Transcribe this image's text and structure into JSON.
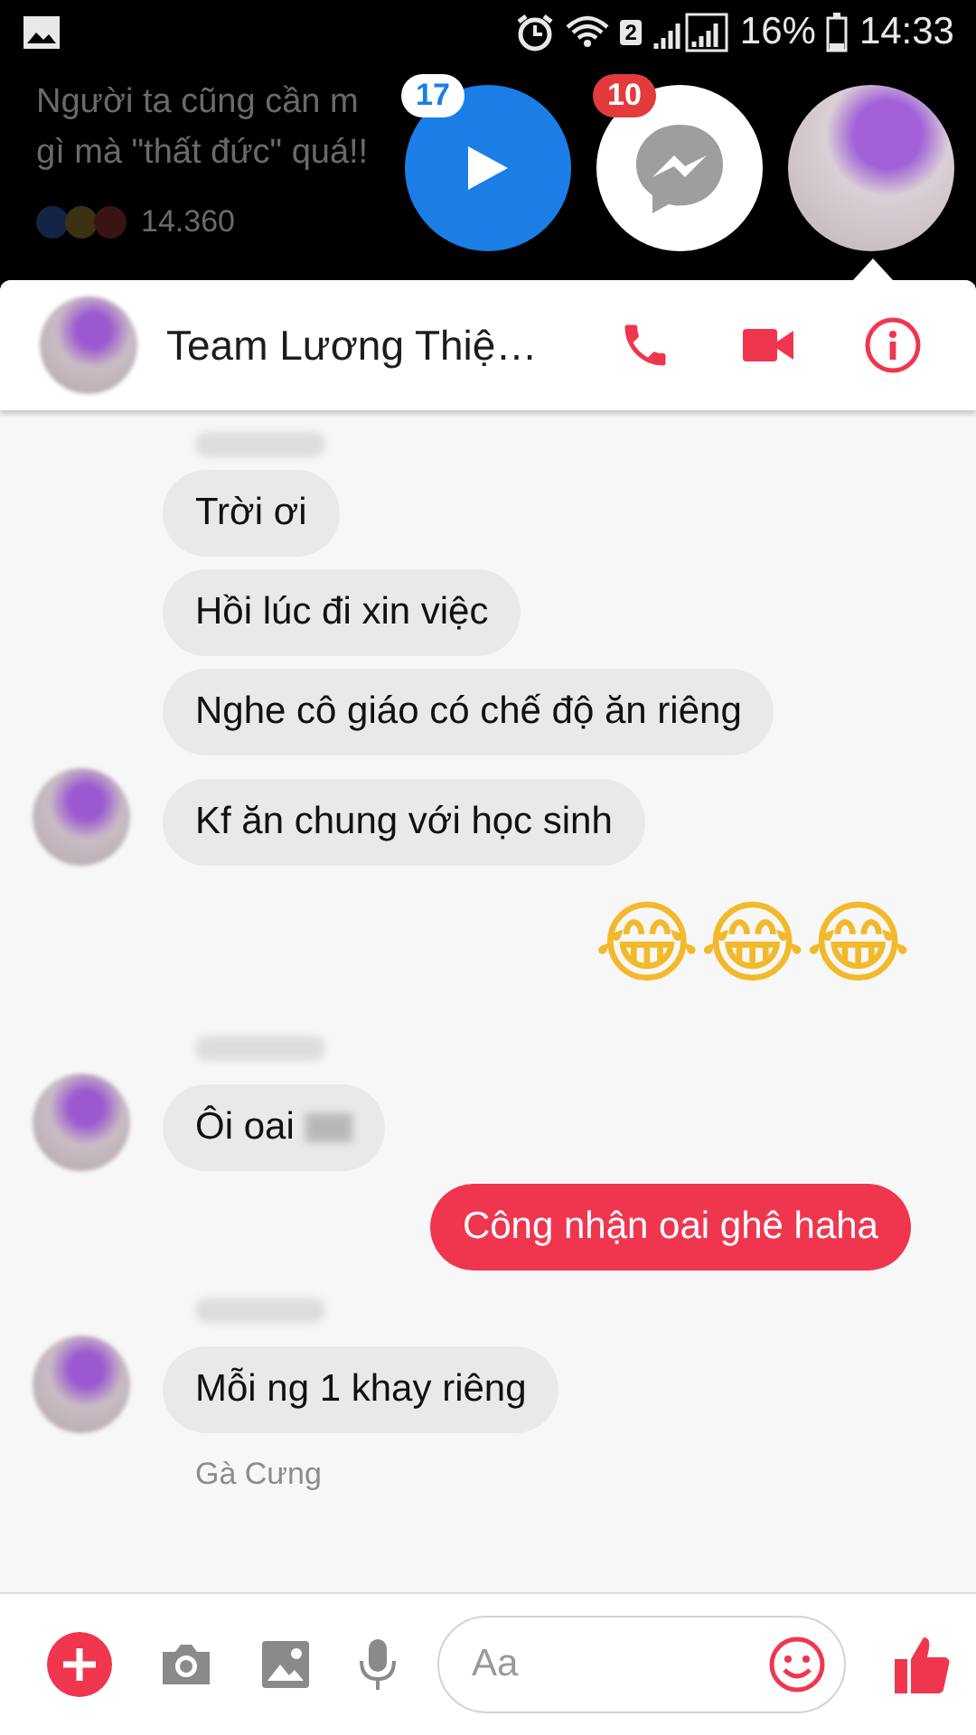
{
  "status_bar": {
    "sim": "2",
    "battery": "16%",
    "time": "14:33"
  },
  "background_post": {
    "lines": [
      "Người ta cũng cần m",
      "gì mà \"thất đức\" quá!!"
    ],
    "reactions": "14.360"
  },
  "chat_heads": [
    {
      "kind": "video",
      "badge": "17"
    },
    {
      "kind": "messenger",
      "badge": "10"
    },
    {
      "kind": "avatar"
    }
  ],
  "conversation": {
    "title": "Team Lương Thiệ…"
  },
  "messages": [
    {
      "kind": "received",
      "text": "Trời ơi",
      "avatar": false,
      "name_blurred": true
    },
    {
      "kind": "received",
      "text": "Hồi lúc đi xin việc",
      "avatar": false,
      "name_blurred": false
    },
    {
      "kind": "received",
      "text": "Nghe cô giáo có chế độ ăn riêng",
      "avatar": false,
      "name_blurred": false
    },
    {
      "kind": "received",
      "text": "Kf ăn chung với học sinh",
      "avatar": true,
      "name_blurred": false
    },
    {
      "kind": "emoji",
      "text": "😂😂😂"
    },
    {
      "kind": "received",
      "text": "Ôi oai",
      "avatar": true,
      "name_blurred": true,
      "blurred_tail": true
    },
    {
      "kind": "sent",
      "text": "Công nhận oai ghê haha"
    },
    {
      "kind": "received",
      "text": "Mỗi ng 1 khay riêng",
      "avatar": true,
      "name_blurred": true
    }
  ],
  "footer_sender": "Gà Cưng",
  "composer": {
    "placeholder": "Aa"
  }
}
